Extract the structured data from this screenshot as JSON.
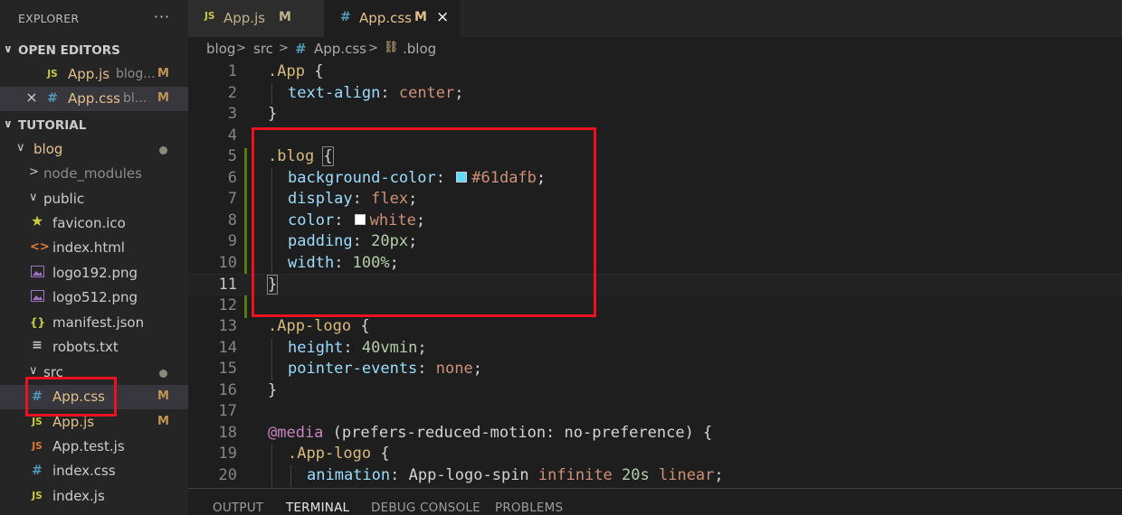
{
  "explorer": {
    "title": "EXPLORER",
    "more_icon": "ellipsis-icon"
  },
  "open_editors": {
    "label": "OPEN EDITORS",
    "items": [
      {
        "icon": "JS",
        "name": "App.js",
        "path": "blog...",
        "badge": "M"
      },
      {
        "close": "×",
        "icon": "#",
        "name": "App.css",
        "path": "bl...",
        "badge": "M"
      }
    ]
  },
  "workspace": {
    "label": "TUTORIAL",
    "tree": [
      {
        "name": "blog",
        "chevron": "∨"
      },
      {
        "name": "node_modules",
        "chevron": ">"
      },
      {
        "name": "public",
        "chevron": "∨"
      },
      {
        "icon": "★",
        "name": "favicon.ico"
      },
      {
        "icon": "<>",
        "name": "index.html"
      },
      {
        "icon": "img",
        "name": "logo192.png"
      },
      {
        "icon": "img",
        "name": "logo512.png"
      },
      {
        "icon": "{}",
        "name": "manifest.json"
      },
      {
        "icon": "≡",
        "name": "robots.txt"
      },
      {
        "name": "src",
        "chevron": "∨"
      },
      {
        "icon": "#",
        "name": "App.css",
        "badge": "M"
      },
      {
        "icon": "JS",
        "name": "App.js",
        "badge": "M"
      },
      {
        "icon": "JS",
        "name": "App.test.js"
      },
      {
        "icon": "#",
        "name": "index.css"
      },
      {
        "icon": "JS",
        "name": "index.js"
      }
    ]
  },
  "tabs": [
    {
      "icon": "JS",
      "name": "App.js",
      "badge": "M"
    },
    {
      "icon": "#",
      "name": "App.css",
      "badge": "M",
      "close": "×"
    }
  ],
  "breadcrumb": {
    "parts": [
      "blog",
      ">",
      "src",
      ">",
      "#",
      "App.css",
      ">",
      ".blog"
    ]
  },
  "editor": {
    "line_numbers": [
      "1",
      "2",
      "3",
      "4",
      "5",
      "6",
      "7",
      "8",
      "9",
      "10",
      "11",
      "12",
      "13",
      "14",
      "15",
      "16",
      "17",
      "18",
      "19",
      "20"
    ],
    "tokens": {
      "l1_sel": ".App",
      "l1_brace": " {",
      "l2_prop": "text-align",
      "l2_colon": ": ",
      "l2_val": "center",
      "l2_semi": ";",
      "l3": "}",
      "l5_sel": ".blog ",
      "l5_brace": "{",
      "l6_prop": "background-color",
      "l6_colon": ": ",
      "l6_val": "#61dafb",
      "l6_semi": ";",
      "l7_prop": "display",
      "l7_colon": ": ",
      "l7_val": "flex",
      "l7_semi": ";",
      "l8_prop": "color",
      "l8_colon": ": ",
      "l8_val": "white",
      "l8_semi": ";",
      "l9_prop": "padding",
      "l9_colon": ": ",
      "l9_val": "20px",
      "l9_semi": ";",
      "l10_prop": "width",
      "l10_colon": ": ",
      "l10_val": "100%",
      "l10_semi": ";",
      "l11": "}",
      "l13_sel": ".App-logo",
      "l13_brace": " {",
      "l14_prop": "height",
      "l14_colon": ": ",
      "l14_val": "40vmin",
      "l14_semi": ";",
      "l15_prop": "pointer-events",
      "l15_colon": ": ",
      "l15_val": "none",
      "l15_semi": ";",
      "l16": "}",
      "l18_at": "@media",
      "l18_rest": " (prefers-reduced-motion: no-preference) {",
      "l19_sel": ".App-logo",
      "l19_brace": " {",
      "l20_prop": "animation",
      "l20_colon": ": ",
      "l20_v1": "App-logo-spin ",
      "l20_v2": "infinite ",
      "l20_v3": "20s",
      "l20_v4": " linear",
      "l20_semi": ";"
    },
    "swatch_colors": {
      "bg": "#61dafb",
      "white": "#ffffff"
    }
  },
  "panel": {
    "tabs": [
      "OUTPUT",
      "TERMINAL",
      "DEBUG CONSOLE",
      "PROBLEMS"
    ],
    "active": "TERMINAL"
  }
}
